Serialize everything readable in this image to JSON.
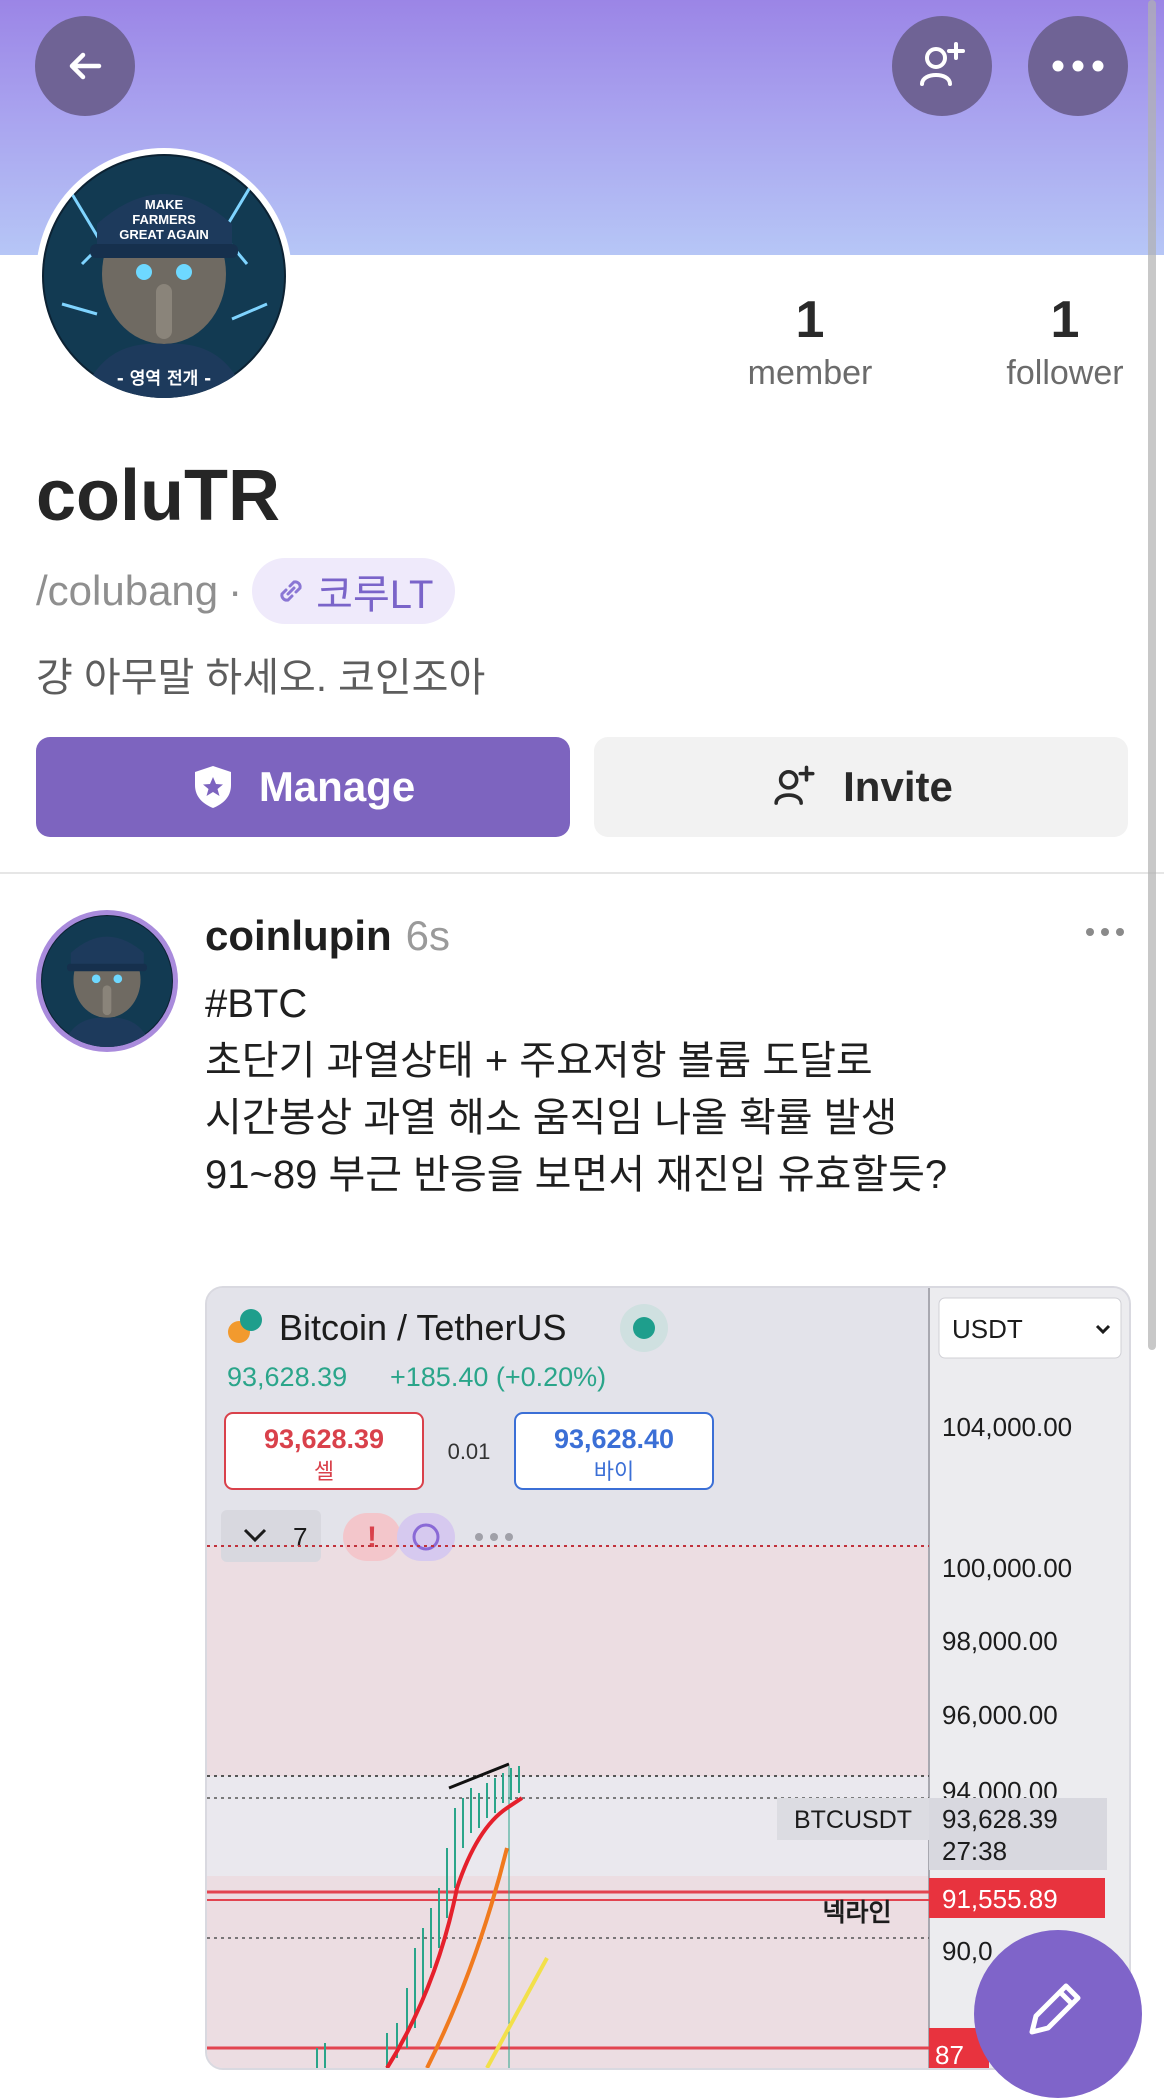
{
  "profile": {
    "title": "coluTR",
    "handle": "/colubang",
    "separator": "·",
    "link_label": "코루LT",
    "bio": "걍 아무말 하세오. 코인조아",
    "avatar_caption": "MAKE FARMERS GREAT AGAIN",
    "avatar_subcaption": "- 영역 전개 -",
    "stats": [
      {
        "value": "1",
        "label": "member"
      },
      {
        "value": "1",
        "label": "follower"
      }
    ]
  },
  "actions": {
    "manage_label": "Manage",
    "invite_label": "Invite"
  },
  "post": {
    "author": "coinlupin",
    "time": "6s",
    "lines": [
      "#BTC",
      "초단기 과열상태 + 주요저항 볼륨 도달로",
      "시간봉상 과열 해소 움직임 나올 확률 발생",
      "",
      "91~89 부근 반응을 보면서 재진입 유효할듯?"
    ],
    "chart": {
      "pair": "Bitcoin / TetherUS",
      "currency": "USDT",
      "price_line": "93,628.39",
      "change_line": "+185.40 (+0.20%)",
      "sell_price": "93,628.39",
      "sell_label": "셀",
      "spread": "0.01",
      "buy_price": "93,628.40",
      "buy_label": "바이",
      "indicator_count": "7",
      "symbol_tag": "BTCUSDT",
      "current_price": "93,628.39",
      "countdown": "27:38",
      "neck_price": "91,555.89",
      "neck_label": "넥라인",
      "axis_labels": [
        "104,000.00",
        "100,000.00",
        "98,000.00",
        "96,000.00",
        "94,000.00",
        "90,0"
      ],
      "axis_bottom_partial": "87"
    }
  },
  "colors": {
    "accent": "#7d64bf",
    "banner_top": "#9b85e6",
    "banner_bottom": "#b6c6f6",
    "sell_red": "#e0434d",
    "buy_blue": "#3b6fd6",
    "up_green": "#26a69a"
  },
  "icons": {
    "back": "arrow-left-icon",
    "add_member": "person-plus-icon",
    "more": "more-horizontal-icon",
    "manage": "shield-star-icon",
    "invite": "person-plus-icon",
    "link": "link-icon",
    "compose": "pencil-icon"
  }
}
